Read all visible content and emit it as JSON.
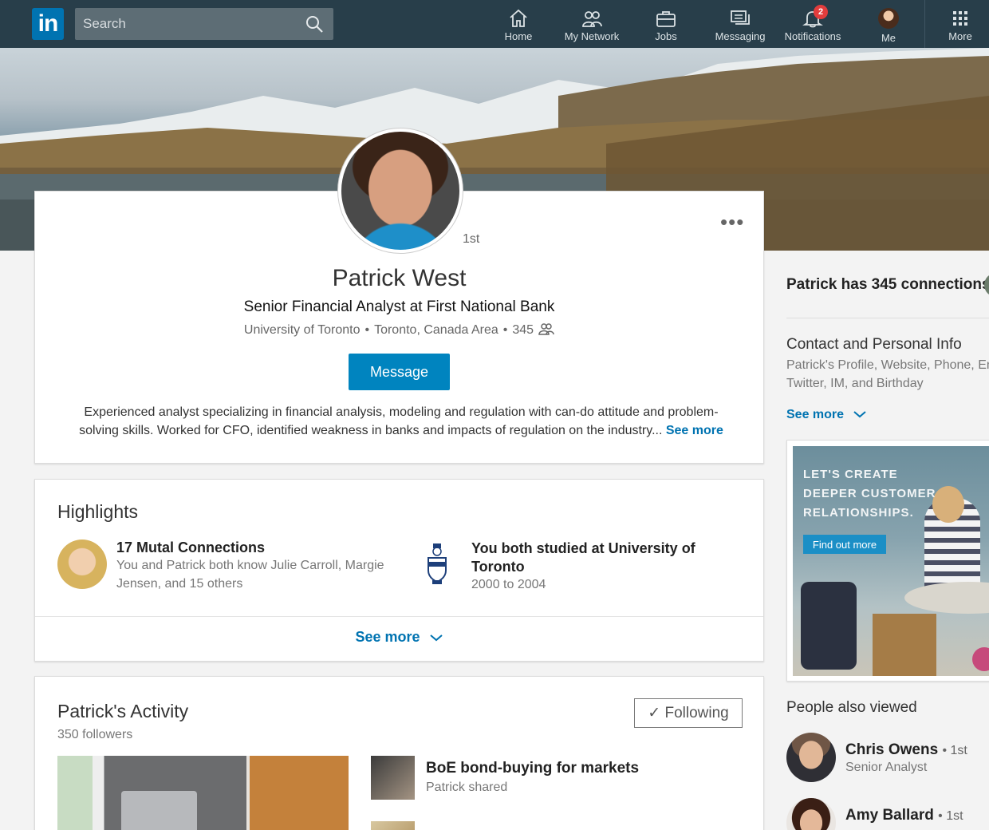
{
  "nav": {
    "logo": "in",
    "search_placeholder": "Search",
    "items": [
      {
        "label": "Home"
      },
      {
        "label": "My Network"
      },
      {
        "label": "Jobs"
      },
      {
        "label": "Messaging"
      },
      {
        "label": "Notifications",
        "badge": "2"
      },
      {
        "label": "Me"
      },
      {
        "label": "More"
      }
    ]
  },
  "profile": {
    "name": "Patrick West",
    "degree": "1st",
    "headline": "Senior Financial Analyst at First National Bank",
    "school": "University of Toronto",
    "location": "Toronto, Canada Area",
    "connections": "345",
    "message_label": "Message",
    "summary": "Experienced analyst specializing in financial analysis, modeling and regulation with can-do attitude and problem-solving skills. Worked for CFO, identified weakness in banks and impacts of regulation on the industry...",
    "see_more": "See more"
  },
  "highlights": {
    "title": "Highlights",
    "mutual": {
      "heading": "17 Mutal Connections",
      "text": "You and Patrick both know Julie Carroll, Margie Jensen, and 15 others"
    },
    "school": {
      "heading": "You both studied at University of Toronto",
      "years": "2000 to 2004"
    },
    "see_more": "See more"
  },
  "activity": {
    "title": "Patrick's Activity",
    "followers": "350 followers",
    "following_label": "Following",
    "posts": [
      {
        "title": "BoE bond-buying for markets",
        "meta": "Patrick shared"
      }
    ]
  },
  "right_rail": {
    "connections_title": "Patrick has 345 connections",
    "contact_title": "Contact and Personal Info",
    "contact_sub": "Patrick's Profile, Website, Phone, Email, Twitter, IM, and Birthday",
    "see_more": "See more",
    "ad": {
      "headline": "LET'S CREATE DEEPER CUSTOMER RELATIONSHIPS.",
      "cta": "Find out more"
    },
    "people_also_viewed": {
      "title": "People also viewed",
      "people": [
        {
          "name": "Chris Owens",
          "degree": "1st",
          "role": "Senior Analyst"
        },
        {
          "name": "Amy Ballard",
          "degree": "1st",
          "role": ""
        }
      ]
    }
  },
  "colors": {
    "nav_bg": "#283e4a",
    "brand_blue": "#0073b1",
    "message_button": "#0084bf",
    "badge_red": "#e23d3d"
  }
}
